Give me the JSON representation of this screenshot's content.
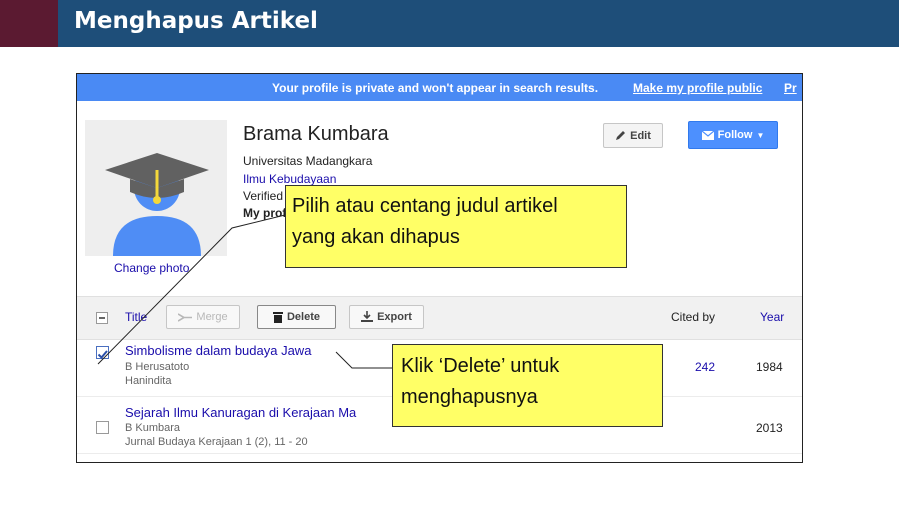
{
  "slide": {
    "title": "Menghapus Artikel",
    "header_color": "#1e4e79",
    "accent_color": "#5b1a31"
  },
  "banner": {
    "message": "Your profile is private and won't appear in search results.",
    "link_public": "Make my profile public",
    "link_cut": "Pr",
    "color": "#4a8af4"
  },
  "profile": {
    "name": "Brama Kumbara",
    "affiliation": "Universitas Madangkara",
    "keywords": "Ilmu Kebudayaan",
    "verified": "Verified",
    "my_profile": "My prof",
    "change_photo": "Change photo",
    "edit_label": "Edit",
    "follow_label": "Follow",
    "photo_icon": "scholar-avatar-icon"
  },
  "toolbar": {
    "title_col": "Title",
    "merge_label": "Merge",
    "delete_label": "Delete",
    "export_label": "Export",
    "cited_col": "Cited by",
    "year_col": "Year"
  },
  "articles": [
    {
      "title": "Simbolisme dalam budaya Jawa",
      "authors": "B Herusatoto",
      "venue": "Hanindita",
      "cited": "242",
      "year": "1984",
      "checked": true
    },
    {
      "title": "Sejarah Ilmu Kanuragan di Kerajaan Ma",
      "authors": "B Kumbara",
      "venue": "Jurnal Budaya Kerajaan 1 (2), 11 - 20",
      "cited": "",
      "year": "2013",
      "checked": false
    }
  ],
  "callouts": {
    "select_line1": "Pilih atau centang judul artikel",
    "select_line2": "yang akan dihapus",
    "delete_line1": "Klik ‘Delete’ untuk",
    "delete_line2": "menghapusnya",
    "color": "#ffff66"
  }
}
